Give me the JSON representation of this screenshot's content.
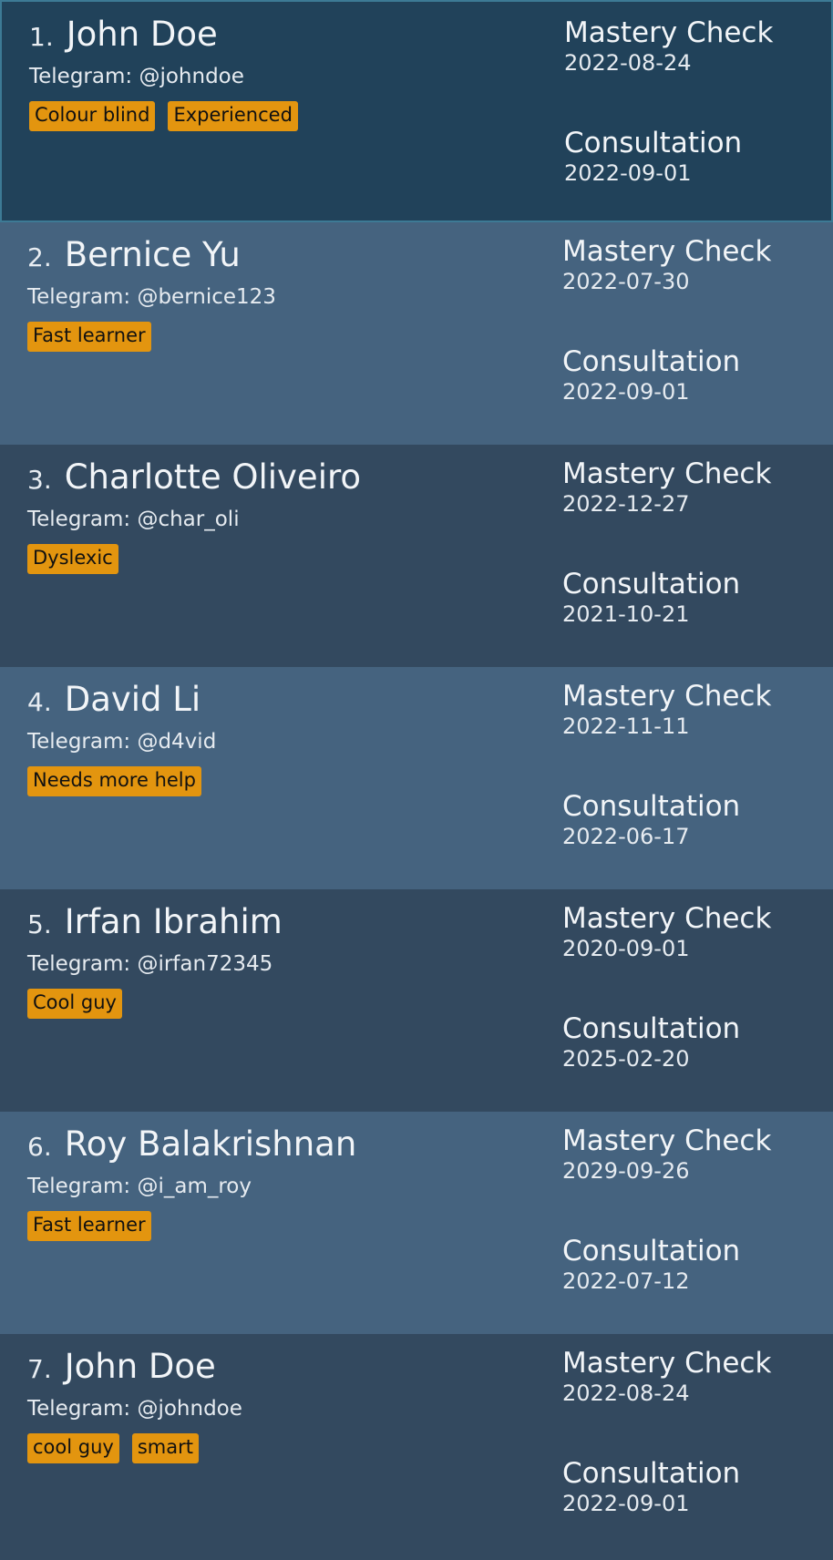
{
  "students": [
    {
      "index": "1.",
      "name": "John Doe",
      "telegram_label": "Telegram:",
      "telegram": "@johndoe",
      "tags": [
        "Colour blind",
        "Experienced"
      ],
      "mastery_label": "Mastery Check",
      "mastery_date": "2022-08-24",
      "consult_label": "Consultation",
      "consult_date": "2022-09-01",
      "selected": true
    },
    {
      "index": "2.",
      "name": "Bernice Yu",
      "telegram_label": "Telegram:",
      "telegram": "@bernice123",
      "tags": [
        "Fast learner"
      ],
      "mastery_label": "Mastery Check",
      "mastery_date": "2022-07-30",
      "consult_label": "Consultation",
      "consult_date": "2022-09-01"
    },
    {
      "index": "3.",
      "name": "Charlotte Oliveiro",
      "telegram_label": "Telegram:",
      "telegram": "@char_oli",
      "tags": [
        "Dyslexic"
      ],
      "mastery_label": "Mastery Check",
      "mastery_date": "2022-12-27",
      "consult_label": "Consultation",
      "consult_date": "2021-10-21"
    },
    {
      "index": "4.",
      "name": "David Li",
      "telegram_label": "Telegram:",
      "telegram": "@d4vid",
      "tags": [
        "Needs more help"
      ],
      "mastery_label": "Mastery Check",
      "mastery_date": "2022-11-11",
      "consult_label": "Consultation",
      "consult_date": "2022-06-17"
    },
    {
      "index": "5.",
      "name": "Irfan Ibrahim",
      "telegram_label": "Telegram:",
      "telegram": "@irfan72345",
      "tags": [
        "Cool guy"
      ],
      "mastery_label": "Mastery Check",
      "mastery_date": "2020-09-01",
      "consult_label": "Consultation",
      "consult_date": "2025-02-20"
    },
    {
      "index": "6.",
      "name": "Roy Balakrishnan",
      "telegram_label": "Telegram:",
      "telegram": "@i_am_roy",
      "tags": [
        "Fast learner"
      ],
      "mastery_label": "Mastery Check",
      "mastery_date": "2029-09-26",
      "consult_label": "Consultation",
      "consult_date": "2022-07-12"
    },
    {
      "index": "7.",
      "name": "John Doe",
      "telegram_label": "Telegram:",
      "telegram": "@johndoe",
      "tags": [
        "cool guy",
        "smart"
      ],
      "mastery_label": "Mastery Check",
      "mastery_date": "2022-08-24",
      "consult_label": "Consultation",
      "consult_date": "2022-09-01"
    }
  ],
  "colors": {
    "card_dark": "#33495f",
    "card_light": "#45637f",
    "card_selected": "#21425a",
    "tag_bg": "#e3950f"
  }
}
